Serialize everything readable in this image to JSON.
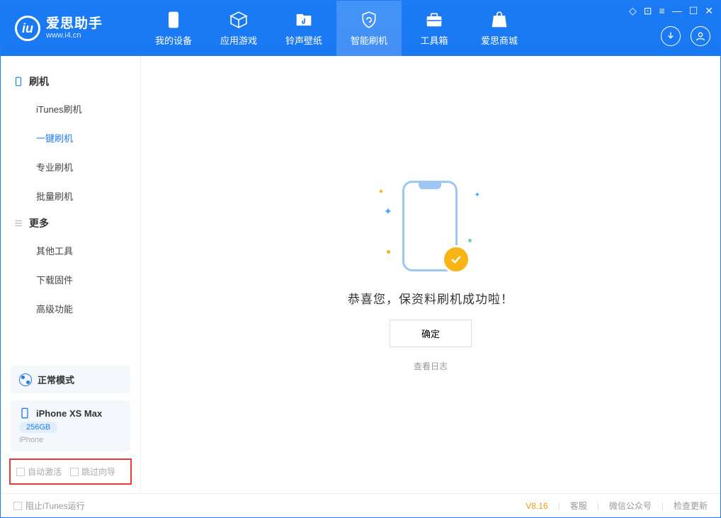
{
  "app": {
    "title": "爱思助手",
    "subtitle": "www.i4.cn"
  },
  "tabs": [
    {
      "label": "我的设备"
    },
    {
      "label": "应用游戏"
    },
    {
      "label": "铃声壁纸"
    },
    {
      "label": "智能刷机"
    },
    {
      "label": "工具箱"
    },
    {
      "label": "爱思商城"
    }
  ],
  "sidebar": {
    "section1": {
      "title": "刷机",
      "items": [
        "iTunes刷机",
        "一键刷机",
        "专业刷机",
        "批量刷机"
      ]
    },
    "section2": {
      "title": "更多",
      "items": [
        "其他工具",
        "下载固件",
        "高级功能"
      ]
    }
  },
  "mode": {
    "label": "正常模式"
  },
  "device": {
    "name": "iPhone XS Max",
    "capacity": "256GB",
    "type": "iPhone"
  },
  "options": {
    "auto_activate": "自动激活",
    "skip_guide": "跳过向导"
  },
  "main": {
    "success_msg": "恭喜您，保资料刷机成功啦！",
    "ok_label": "确定",
    "log_link": "查看日志"
  },
  "footer": {
    "block_itunes": "阻止iTunes运行",
    "version": "V8.16",
    "links": [
      "客服",
      "微信公众号",
      "检查更新"
    ]
  }
}
